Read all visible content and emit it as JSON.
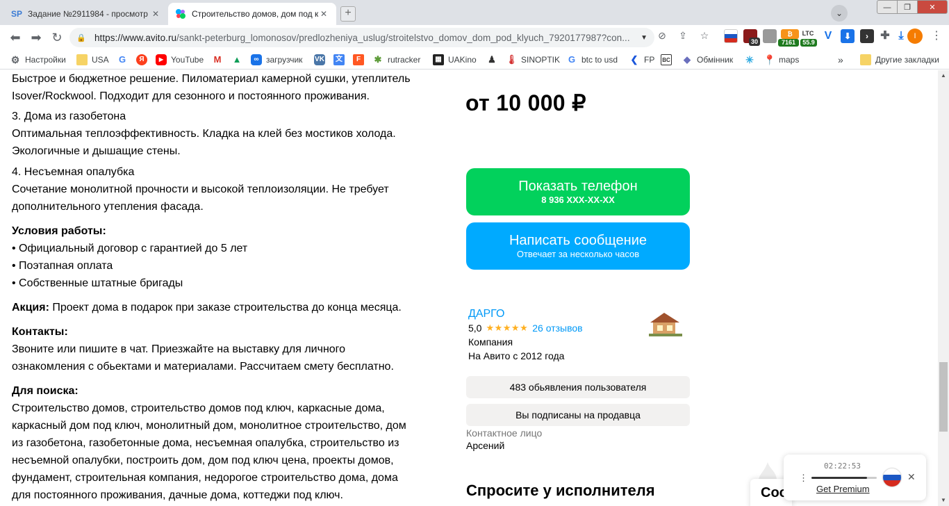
{
  "browser": {
    "tabs": [
      {
        "label": "Задание №2911984 - просмотр з",
        "favicon": "SP"
      },
      {
        "label": "Строительство домов, дом под к",
        "favicon": "avito-icon"
      }
    ],
    "url_host": "https://www.avito.ru",
    "url_path": "/sankt-peterburg_lomonosov/predlozheniya_uslug/stroitelstvo_domov_dom_pod_klyuch_7920177987?con...",
    "extensions": {
      "badge_30": "30",
      "btc_price": "7161",
      "ltc_label": "LTC",
      "ltc_price": "55.9"
    },
    "profile_initial": "I",
    "bookmarks": [
      {
        "label": "Настройки",
        "icon": "gear-icon"
      },
      {
        "label": "USA",
        "icon": "folder-icon"
      },
      {
        "label": "",
        "icon": "google-icon"
      },
      {
        "label": "",
        "icon": "yandex-icon"
      },
      {
        "label": "YouTube",
        "icon": "youtube-icon"
      },
      {
        "label": "",
        "icon": "gmail-icon"
      },
      {
        "label": "",
        "icon": "drive-icon"
      },
      {
        "label": "загрузчик",
        "icon": "loop-icon"
      },
      {
        "label": "",
        "icon": "vk-icon"
      },
      {
        "label": "",
        "icon": "translate-icon"
      },
      {
        "label": "",
        "icon": "f-icon"
      },
      {
        "label": "rutracker",
        "icon": "rutracker-icon"
      },
      {
        "label": "UAKino",
        "icon": "film-icon"
      },
      {
        "label": "",
        "icon": "person-icon"
      },
      {
        "label": "SINOPTIK",
        "icon": "thermometer-icon"
      },
      {
        "label": "btc to usd",
        "icon": "google-icon"
      },
      {
        "label": "FP",
        "icon": "fp-icon"
      },
      {
        "label": "",
        "icon": "bc-icon"
      },
      {
        "label": "Обмінник",
        "icon": "diamond-icon"
      },
      {
        "label": "",
        "icon": "snowflake-icon"
      },
      {
        "label": "maps",
        "icon": "maps-icon"
      }
    ],
    "more_bookmarks": "»",
    "other_bookmarks": "Другие закладки"
  },
  "description": {
    "lines_top": [
      "Быстрое и бюджетное решение. Пиломатериал камерной сушки, утеплитель",
      "Isover/Rockwool. Подходит для сезонного и постоянного проживания."
    ],
    "item3_title": "3. Дома из газобетона",
    "item3_text": [
      "Оптимальная теплоэффективность. Кладка на клей без мостиков холода.",
      "Экологичные и дышащие стены."
    ],
    "item4_title": "4. Несъемная опалубка",
    "item4_text": [
      "Сочетание монолитной прочности и высокой теплоизоляции. Не требует",
      "дополнительного утепления фасада."
    ],
    "conditions_title": "Условия работы:",
    "conditions": [
      "• Официальный договор с гарантией до 5 лет",
      "• Поэтапная оплата",
      "• Собственные штатные бригады"
    ],
    "promo_label": "Акция:",
    "promo_text": " Проект дома в подарок при заказе строительства до конца месяца.",
    "contacts_title": "Контакты:",
    "contacts_text": [
      "Звоните или пишите в чат. Приезжайте на выставку для личного",
      "ознакомления с обьектами и материалами. Рассчитаем смету бесплатно."
    ],
    "search_title": "Для поиска:",
    "search_text": [
      "Строительство домов, строительство домов под ключ, каркасные дома,",
      "каркасный дом под ключ, монолитный дом, монолитное строительство, дом",
      "из газобетона, газобетонные дома, несъемная опалубка, строительство из",
      "несъемной опалубки, построить дом, дом под ключ цена, проекты домов,",
      "фундамент, строительная компания, недорогое строительство дома, дома",
      "для постоянного проживания, дачные дома, коттеджи под ключ."
    ]
  },
  "sidebar": {
    "price": "от 10 000 ₽",
    "phone_button": {
      "label": "Показать телефон",
      "sub": "8 936 XXX-XX-XX",
      "color": "#02d15c"
    },
    "message_button": {
      "label": "Написать сообщение",
      "sub": "Отвечает за несколько часов",
      "color": "#00aaff"
    },
    "seller": {
      "name": "ДАРГО",
      "rating": "5,0",
      "stars": 5,
      "reviews": "26 отзывов",
      "type": "Компания",
      "since": "На Авито с 2012 года"
    },
    "listings_button": "483 обьявления пользователя",
    "subscribed_button": "Вы подписаны на продавца",
    "contact_label": "Контактное лицо",
    "contact_name": "Арсений",
    "ask_title": "Спросите у исполнителя",
    "chat_tab": "Соо"
  },
  "player": {
    "time": "02:22:53",
    "progress": 0.85,
    "premium_link": "Get Premium"
  }
}
